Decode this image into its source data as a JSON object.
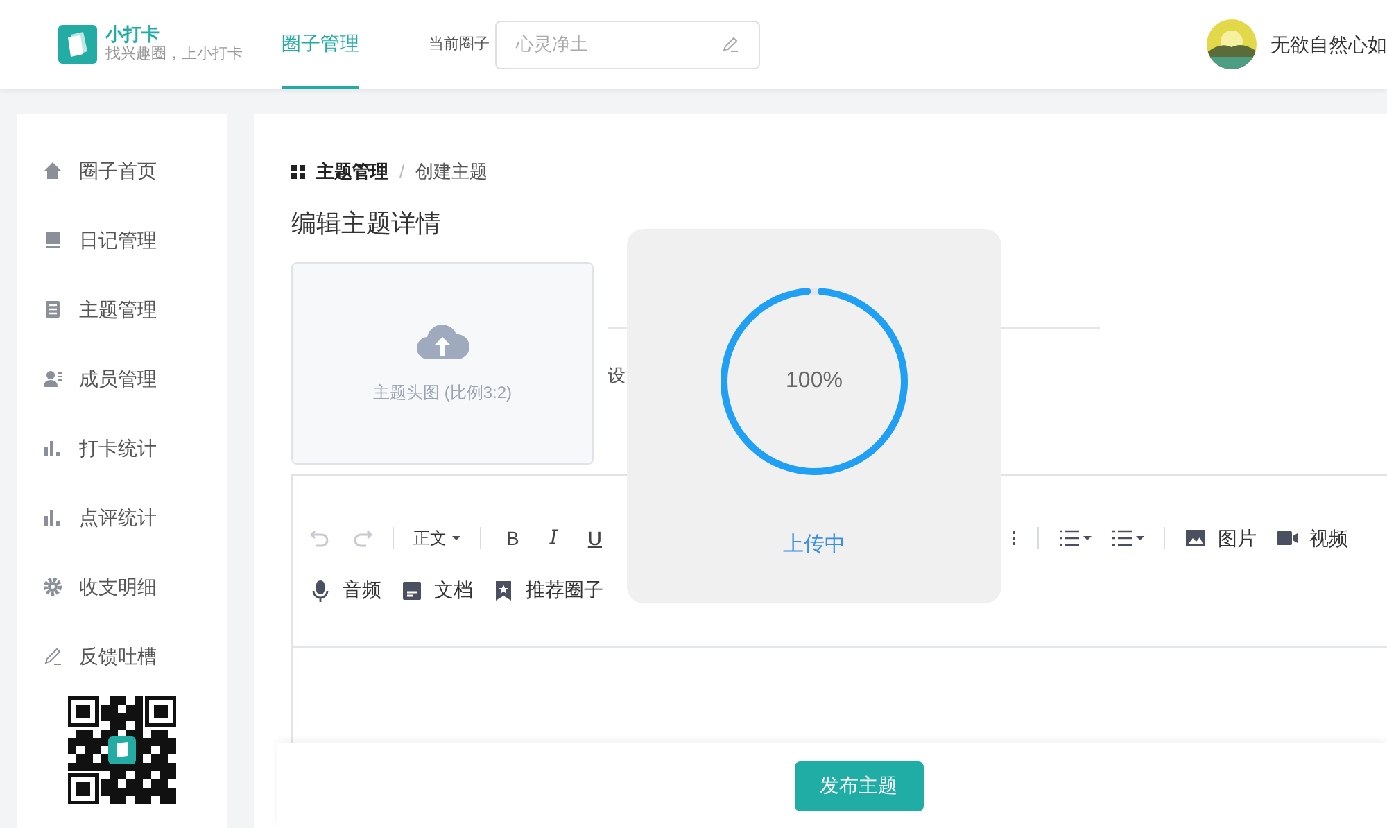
{
  "header": {
    "logo": {
      "title": "小打卡",
      "slogan": "找兴趣圈，上小打卡"
    },
    "nav": [
      {
        "label": "圈子管理",
        "selected": true
      }
    ],
    "circle_label": "当前圈子",
    "circle_field": {
      "value": "心灵净土"
    },
    "user": {
      "name": "无欲自然心如"
    }
  },
  "sidebar": {
    "items": [
      {
        "label": "圈子首页",
        "kind": "home"
      },
      {
        "label": "日记管理",
        "kind": "book"
      },
      {
        "label": "主题管理",
        "kind": "doc"
      },
      {
        "label": "成员管理",
        "kind": "member"
      },
      {
        "label": "打卡统计",
        "kind": "chart"
      },
      {
        "label": "点评统计",
        "kind": "chart"
      },
      {
        "label": "收支明细",
        "kind": "gear"
      },
      {
        "label": "反馈吐槽",
        "kind": "pen"
      }
    ]
  },
  "breadcrumb": [
    "主题管理",
    "/",
    "创建主题"
  ],
  "page_title": "编辑主题详情",
  "upload": {
    "label": "主题头图 (比例3:2)"
  },
  "setting_label": "设",
  "toolbar": {
    "row_1": [
      {
        "kind": "undo"
      },
      {
        "kind": "redo"
      },
      {
        "kind": "sep"
      },
      {
        "kind": "dropdown",
        "label": "正文"
      },
      {
        "kind": "sep"
      },
      {
        "kind": "bold",
        "label": "B"
      },
      {
        "kind": "italic",
        "label": "I"
      },
      {
        "kind": "underline",
        "label": "U"
      },
      {
        "kind": "gap"
      },
      {
        "kind": "vdots"
      },
      {
        "kind": "sep"
      },
      {
        "kind": "olist"
      },
      {
        "kind": "ulist"
      },
      {
        "kind": "sep"
      },
      {
        "kind": "image",
        "label": "图片"
      },
      {
        "kind": "video",
        "label": "视频"
      }
    ],
    "row_2": [
      {
        "kind": "mic",
        "label": "音频"
      },
      {
        "kind": "file",
        "label": "文档"
      },
      {
        "kind": "bookmark",
        "label": "推荐圈子"
      }
    ]
  },
  "upload_modal": {
    "percent": "100%",
    "level": 1,
    "status": "上传中"
  },
  "publish_button": "发布主题"
}
